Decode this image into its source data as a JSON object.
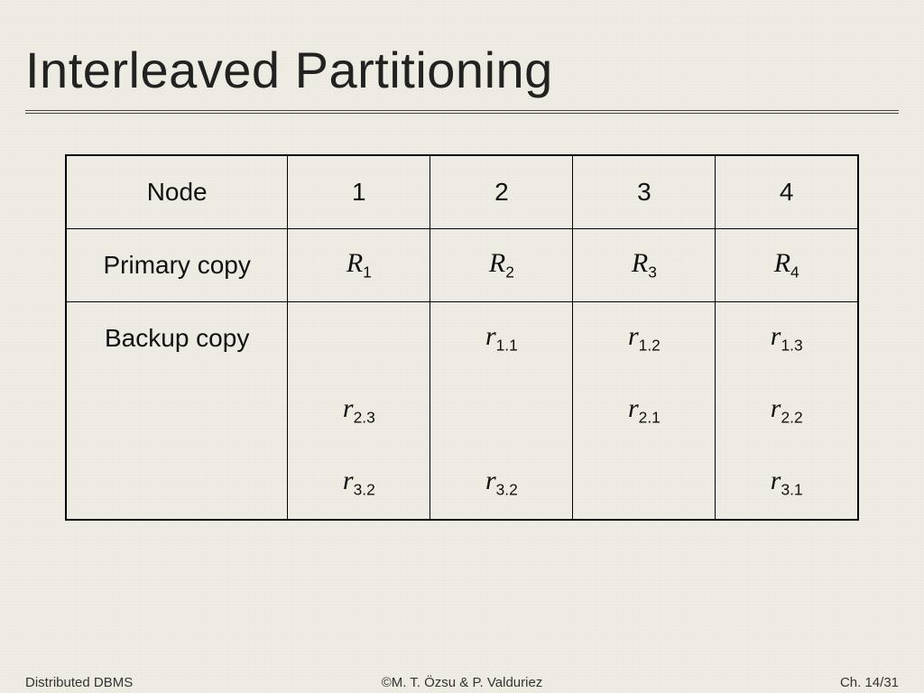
{
  "title": "Interleaved Partitioning",
  "headers": {
    "node": "Node",
    "c1": "1",
    "c2": "2",
    "c3": "3",
    "c4": "4"
  },
  "rows": {
    "primary": {
      "label": "Primary copy",
      "c1": "R₁",
      "c2": "R₂",
      "c3": "R₃",
      "c4": "R₄"
    },
    "backup1": {
      "label": "Backup copy",
      "c1": "",
      "c2": "r₁.₁",
      "c3": "r₁.₂",
      "c4": "r₁.₃"
    },
    "backup2": {
      "label": "",
      "c1": "r₂.₃",
      "c2": "",
      "c3": "r₂.₁",
      "c4": "r₂.₂"
    },
    "backup3": {
      "label": "",
      "c1": "r₃.₂",
      "c2": "r₃.₂",
      "c3": "",
      "c4": "r₃.₁"
    }
  },
  "footer": {
    "left": "Distributed DBMS",
    "center": "©M. T. Özsu & P. Valduriez",
    "right": "Ch. 14/31"
  },
  "chart_data": {
    "type": "table",
    "title": "Interleaved Partitioning",
    "columns": [
      "Node",
      "1",
      "2",
      "3",
      "4"
    ],
    "rows": [
      [
        "Primary copy",
        "R1",
        "R2",
        "R3",
        "R4"
      ],
      [
        "Backup copy",
        "",
        "r1.1",
        "r1.2",
        "r1.3"
      ],
      [
        "",
        "r2.3",
        "",
        "r2.1",
        "r2.2"
      ],
      [
        "",
        "r3.2",
        "r3.2",
        "",
        "r3.1"
      ]
    ]
  }
}
